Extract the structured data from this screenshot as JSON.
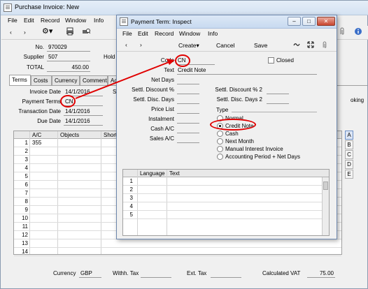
{
  "outer": {
    "title": "Purchase Invoice: New",
    "menu": [
      "File",
      "Edit",
      "Record",
      "Window",
      "Info"
    ],
    "toolbar": {
      "prev": "‹",
      "next": "›"
    },
    "header": {
      "no_label": "No.",
      "no_value": "970029",
      "supplier_label": "Supplier",
      "supplier_value": "507",
      "hold_label": "Hold A",
      "total_label": "TOTAL",
      "total_value": "450.00"
    },
    "tabs": [
      "Terms",
      "Costs",
      "Currency",
      "Comment",
      "Acc"
    ],
    "terms": {
      "invoice_date_label": "Invoice Date",
      "invoice_date_value": "14/1/2016",
      "payment_terms_label": "Payment Terms",
      "payment_terms_value": "CN",
      "transaction_date_label": "Transaction Date",
      "transaction_date_value": "14/1/2016",
      "due_date_label": "Due Date",
      "due_date_value": "14/1/2016",
      "side_cut_s": "S",
      "side_cut_king": "oking"
    },
    "grid": {
      "columns": [
        "A/C",
        "Objects",
        "Short"
      ],
      "rows": [
        {
          "n": "1",
          "ac": "355"
        },
        {
          "n": "2",
          "ac": ""
        },
        {
          "n": "3",
          "ac": ""
        },
        {
          "n": "4",
          "ac": ""
        },
        {
          "n": "5",
          "ac": ""
        },
        {
          "n": "6",
          "ac": ""
        },
        {
          "n": "7",
          "ac": ""
        },
        {
          "n": "8",
          "ac": ""
        },
        {
          "n": "9",
          "ac": ""
        },
        {
          "n": "10",
          "ac": ""
        },
        {
          "n": "11",
          "ac": ""
        },
        {
          "n": "12",
          "ac": ""
        },
        {
          "n": "13",
          "ac": ""
        },
        {
          "n": "14",
          "ac": ""
        }
      ],
      "side_letters": [
        "A",
        "B",
        "C",
        "D",
        "E"
      ]
    },
    "footer": {
      "currency_label": "Currency",
      "currency_value": "GBP",
      "withh_tax_label": "Withh. Tax",
      "ext_tax_label": "Ext. Tax",
      "calc_vat_label": "Calculated VAT",
      "calc_vat_value": "75.00"
    }
  },
  "inner": {
    "title": "Payment Term: Inspect",
    "menu": [
      "File",
      "Edit",
      "Record",
      "Window",
      "Info"
    ],
    "window_buttons": {
      "minimize": "–",
      "maximize": "□",
      "close": "✕"
    },
    "toolbar": {
      "prev": "‹",
      "next": "›",
      "create": "Create",
      "cancel": "Cancel",
      "save": "Save"
    },
    "form": {
      "code_label": "Code",
      "code_value": "CN",
      "closed_label": "Closed",
      "text_label": "Text",
      "text_value": "Credit Note",
      "net_days_label": "Net Days",
      "settl_discount_label": "Settl. Discount %",
      "settl_disc_days_label": "Settl. Disc. Days",
      "settl_discount2_label": "Settl. Discount % 2",
      "settl_disc_days2_label": "Settl. Disc. Days 2",
      "price_list_label": "Price List",
      "instalment_label": "Instalment",
      "cash_ac_label": "Cash A/C",
      "sales_ac_label": "Sales A/C",
      "type_label": "Type",
      "type_options": [
        "Normal",
        "Credit Note",
        "Cash",
        "Next Month",
        "Manual Interest Invoice",
        "Accounting Period + Net Days"
      ],
      "type_selected": "Credit Note"
    },
    "grid": {
      "columns": [
        "Language",
        "Text"
      ],
      "rows": [
        "1",
        "2",
        "3",
        "4",
        "5"
      ]
    }
  },
  "colors": {
    "annotation": "#e00000",
    "title_bar": "#d4e2f2",
    "window_border": "#6d87ad"
  }
}
